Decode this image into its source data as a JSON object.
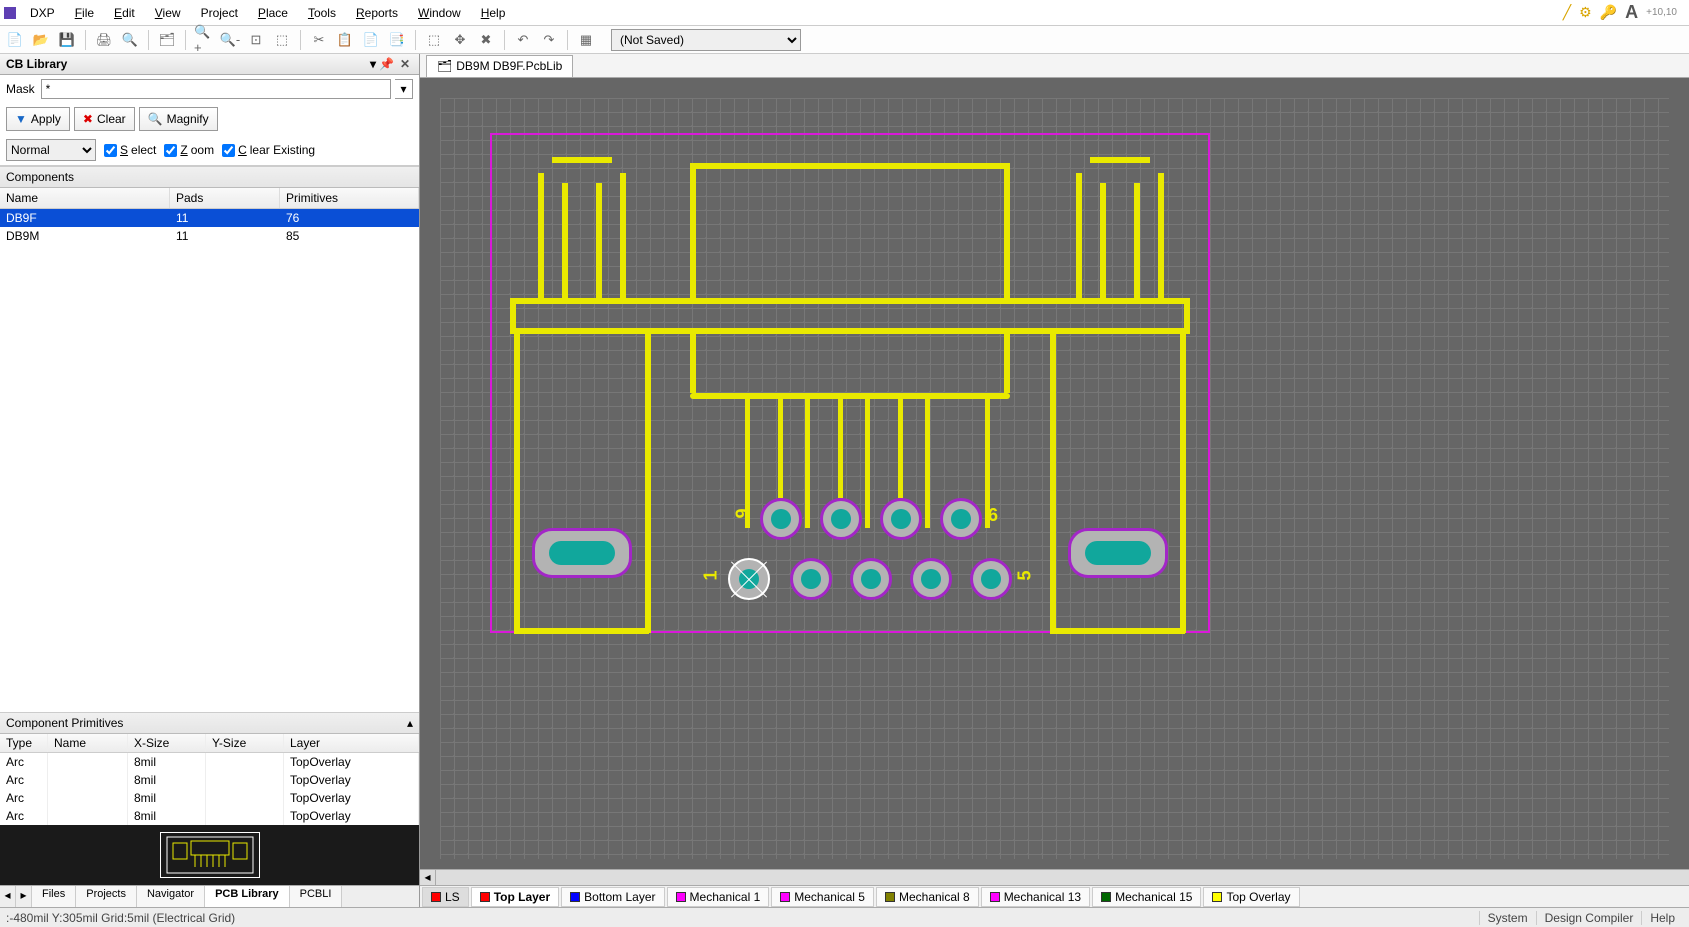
{
  "menu": {
    "items": [
      "DXP",
      "File",
      "Edit",
      "View",
      "Project",
      "Place",
      "Tools",
      "Reports",
      "Window",
      "Help"
    ]
  },
  "toolbar": {
    "save_state": "(Not Saved)"
  },
  "panel": {
    "title": "CB Library",
    "mask_label": "Mask",
    "mask_value": "*",
    "apply": "Apply",
    "clear": "Clear",
    "magnify": "Magnify",
    "mode": "Normal",
    "chk_select": "Select",
    "chk_zoom": "Zoom",
    "chk_clear": "Clear Existing",
    "components_header": "Components",
    "cols": {
      "name": "Name",
      "pads": "Pads",
      "prims": "Primitives"
    },
    "rows": [
      {
        "name": "DB9F",
        "pads": "11",
        "prims": "76"
      },
      {
        "name": "DB9M",
        "pads": "11",
        "prims": "85"
      }
    ],
    "prim_header": "Component Primitives",
    "prim_cols": {
      "type": "Type",
      "name": "Name",
      "x": "X-Size",
      "y": "Y-Size",
      "layer": "Layer"
    },
    "prim_rows": [
      {
        "type": "Arc",
        "name": "",
        "x": "8mil",
        "y": "",
        "layer": "TopOverlay"
      },
      {
        "type": "Arc",
        "name": "",
        "x": "8mil",
        "y": "",
        "layer": "TopOverlay"
      },
      {
        "type": "Arc",
        "name": "",
        "x": "8mil",
        "y": "",
        "layer": "TopOverlay"
      },
      {
        "type": "Arc",
        "name": "",
        "x": "8mil",
        "y": "",
        "layer": "TopOverlay"
      }
    ],
    "bottom_tabs": [
      "Files",
      "Projects",
      "Navigator",
      "PCB Library",
      "PCBLI"
    ]
  },
  "doc_tab": "DB9M DB9F.PcbLib",
  "labels": {
    "one": "1",
    "five": "5",
    "six": "6",
    "nine": "9"
  },
  "layers": [
    {
      "label": "LS",
      "color": "#ff0000",
      "ls": true
    },
    {
      "label": "Top Layer",
      "color": "#ff0000",
      "active": true
    },
    {
      "label": "Bottom Layer",
      "color": "#0000ff"
    },
    {
      "label": "Mechanical 1",
      "color": "#ff00ff"
    },
    {
      "label": "Mechanical 5",
      "color": "#ff00ff"
    },
    {
      "label": "Mechanical 8",
      "color": "#808000"
    },
    {
      "label": "Mechanical 13",
      "color": "#ff00ff"
    },
    {
      "label": "Mechanical 15",
      "color": "#006600"
    },
    {
      "label": "Top Overlay",
      "color": "#ffff00"
    }
  ],
  "status": {
    "coords": ":-480mil Y:305mil   Grid:5mil   (Electrical Grid)",
    "right": [
      "System",
      "Design Compiler",
      "Help"
    ]
  }
}
